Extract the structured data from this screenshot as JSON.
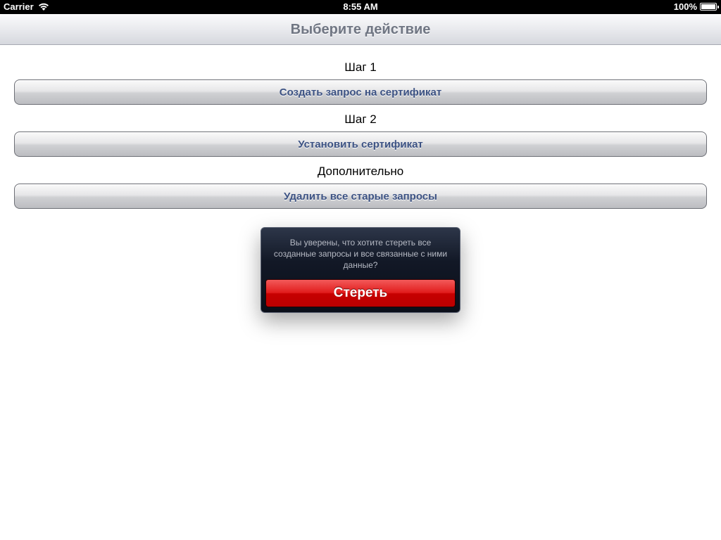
{
  "status_bar": {
    "carrier": "Carrier",
    "time": "8:55 AM",
    "battery": "100%",
    "battery_level": 1.0,
    "icons": [
      "wifi-icon",
      "battery-icon"
    ]
  },
  "nav_bar": {
    "title": "Выберите действие"
  },
  "sections": [
    {
      "label": "Шаг 1",
      "button": "Создать запрос на сертификат"
    },
    {
      "label": "Шаг 2",
      "button": "Установить сертификат"
    },
    {
      "label": "Дополнительно",
      "button": "Удалить все старые запросы"
    }
  ],
  "popover": {
    "message": "Вы уверены, что хотите стереть все созданные запросы и все связанные с ними данные?",
    "erase_label": "Стереть"
  },
  "colors": {
    "button_text": "#3c5283",
    "destructive": "#d40000",
    "popover_bg": "#121826"
  }
}
